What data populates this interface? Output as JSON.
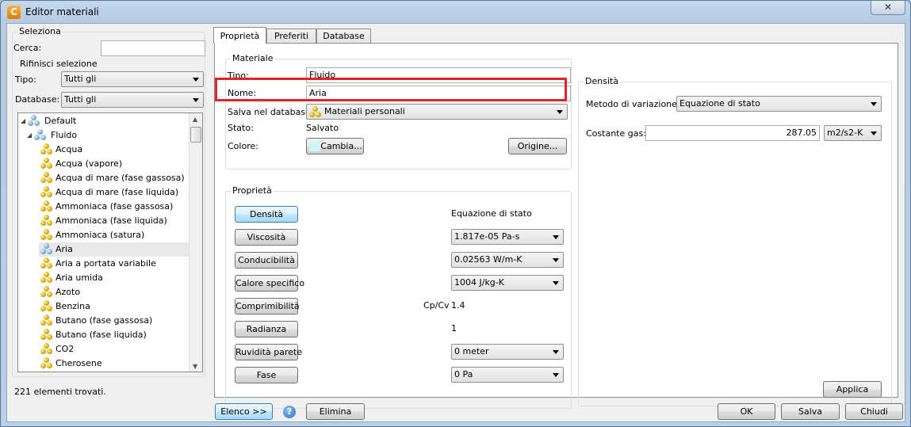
{
  "window": {
    "title": "Editor materiali",
    "close_symbol": "✕",
    "app_icon_letter": "C"
  },
  "left": {
    "seleziona_title": "Seleziona",
    "cerca_label": "Cerca:",
    "cerca_value": "",
    "rifinisci_title": "Rifinisci selezione",
    "tipo_label": "Tipo:",
    "tipo_value": "Tutti gli",
    "database_label": "Database:",
    "database_value": "Tutti gli",
    "tree": {
      "root": "Default",
      "group": "Fluido",
      "items": [
        "Acqua",
        "Acqua (vapore)",
        "Acqua di mare (fase gassosa)",
        "Acqua di mare (fase liquida)",
        "Ammoniaca (fase gassosa)",
        "Ammoniaca (fase liquida)",
        "Ammoniaca (satura)",
        "Aria",
        "Aria a portata variabile",
        "Aria umida",
        "Azoto",
        "Benzina",
        "Butano (fase gassosa)",
        "Butano (fase liquida)",
        "CO2",
        "Cherosene"
      ],
      "selected_item": "Aria"
    },
    "found_count": "221 elementi trovati."
  },
  "tabs": [
    "Proprietà",
    "Preferiti",
    "Database"
  ],
  "materiale": {
    "title": "Materiale",
    "tipo_label": "Tipo:",
    "tipo_value": "Fluido",
    "nome_label": "Nome:",
    "nome_value": "Aria",
    "salva_label": "Salva nel database:",
    "salva_value": "Materiali personali",
    "stato_label": "Stato:",
    "stato_value": "Salvato",
    "colore_label": "Colore:",
    "cambia_button": "Cambia...",
    "origine_button": "Origine...",
    "swatch_color": "#cdf7f7"
  },
  "proprieta": {
    "title": "Proprietà",
    "rows": [
      {
        "button": "Densità",
        "active": true,
        "value": "Equazione di stato",
        "kind": "text"
      },
      {
        "button": "Viscosità",
        "value": "1.817e-05 Pa-s",
        "kind": "combo"
      },
      {
        "button": "Conducibilità",
        "value": "0.02563 W/m-K",
        "kind": "combo"
      },
      {
        "button": "Calore specifico",
        "value": "1004 J/kg-K",
        "kind": "combo"
      },
      {
        "button": "Comprimibilità",
        "prefix": "Cp/Cv",
        "value": "1.4",
        "kind": "text"
      },
      {
        "button": "Radianza",
        "value": "1",
        "kind": "text"
      },
      {
        "button": "Ruvidità parete",
        "value": "0 meter",
        "kind": "combo"
      },
      {
        "button": "Fase",
        "value": "0 Pa",
        "kind": "combo"
      }
    ]
  },
  "densita": {
    "title": "Densità",
    "metodo_label": "Metodo di variazione:",
    "metodo_value": "Equazione di stato",
    "costante_label": "Costante gas:",
    "costante_value": "287.05",
    "costante_unit": "m2/s2-K",
    "applica_button": "Applica"
  },
  "footer": {
    "elenco_button": "Elenco >>",
    "help_symbol": "?",
    "elimina_button": "Elimina",
    "ok_button": "OK",
    "salva_button": "Salva",
    "chiudi_button": "Chiudi"
  },
  "colors": {
    "highlight": "#e0242c",
    "active_button": "#bee6fd"
  }
}
